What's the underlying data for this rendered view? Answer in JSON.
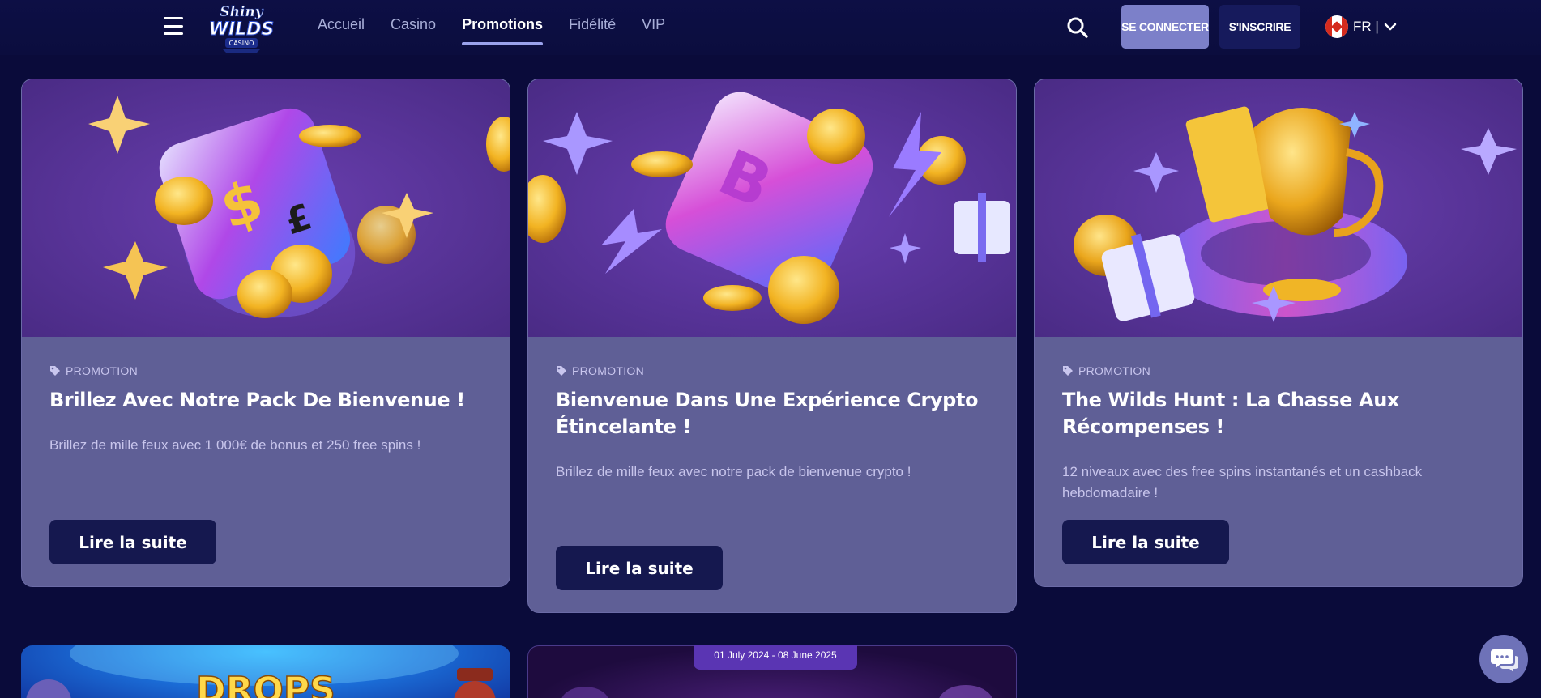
{
  "header": {
    "logo_text": "Shiny WILDS CASINO",
    "nav": [
      "Accueil",
      "Casino",
      "Promotions",
      "Fidélité",
      "VIP"
    ],
    "active_nav": "Promotions",
    "login_label": "SE CONNECTER",
    "signup_label": "S'INSCRIRE",
    "language": "FR |"
  },
  "promotions": [
    {
      "tag": "PROMOTION",
      "title": "Brillez Avec Notre Pack De Bienvenue !",
      "description": "Brillez de mille feux avec 1 000€ de bonus et 250 free spins !",
      "button": "Lire la suite"
    },
    {
      "tag": "PROMOTION",
      "title": "Bienvenue Dans Une Expérience Crypto Étincelante !",
      "description": "Brillez de mille feux avec notre pack de bienvenue crypto !",
      "button": "Lire la suite"
    },
    {
      "tag": "PROMOTION",
      "title": "The Wilds Hunt : La Chasse Aux Récompenses !",
      "description": "12 niveaux avec des free spins instantanés et un cashback hebdomadaire !",
      "button": "Lire la suite"
    }
  ],
  "bottom_cards": {
    "drops_text": "DROPS",
    "date_range": "01 July 2024 - 08 June 2025"
  },
  "colors": {
    "background": "#0a0b3a",
    "card": "#5f5f96",
    "button": "#15184f",
    "login": "#7c80c9"
  }
}
